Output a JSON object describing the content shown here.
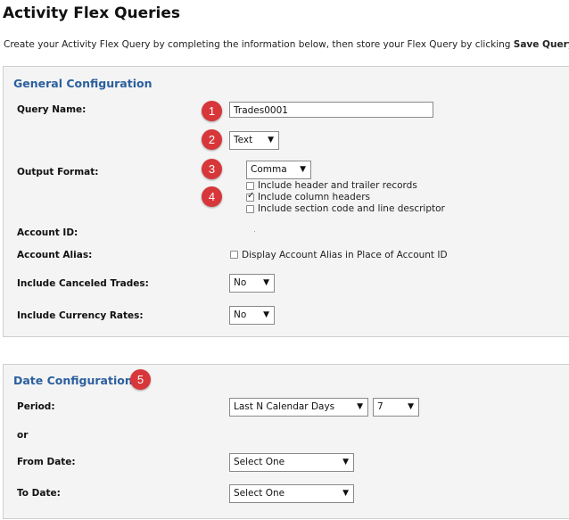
{
  "page": {
    "title": "Activity Flex Queries",
    "intro_text": "Create your Activity Flex Query by completing the information below, then store your Flex Query by clicking ",
    "intro_bold": "Save Query",
    "intro_end": "."
  },
  "general": {
    "section_title": "General Configuration",
    "query_name_label": "Query Name:",
    "query_name_value": "Trades0001",
    "format_type_value": "Text",
    "output_format_label": "Output Format:",
    "delimiter_value": "Comma",
    "checkboxes": [
      {
        "label": "Include header and trailer records",
        "checked": false
      },
      {
        "label": "Include column headers",
        "checked": true
      },
      {
        "label": "Include section code and line descriptor",
        "checked": false
      }
    ],
    "account_id_label": "Account ID:",
    "account_alias_label": "Account Alias:",
    "account_alias_checkbox": {
      "label": "Display Account Alias in Place of Account ID",
      "checked": false
    },
    "canceled_trades_label": "Include Canceled Trades:",
    "canceled_trades_value": "No",
    "currency_rates_label": "Include Currency Rates:",
    "currency_rates_value": "No"
  },
  "date": {
    "section_title": "Date Configuration",
    "period_label": "Period:",
    "period_value": "Last N Calendar Days",
    "period_n_value": "7",
    "or_label": "or",
    "from_date_label": "From Date:",
    "from_date_value": "Select One",
    "to_date_label": "To Date:",
    "to_date_value": "Select One"
  },
  "badges": [
    "1",
    "2",
    "3",
    "4",
    "5"
  ],
  "colors": {
    "badge": "#d7373a",
    "section_title": "#2b5f9e",
    "panel_bg": "#f4f4f4"
  },
  "icons": {
    "dropdown": "triangle-down-icon"
  }
}
